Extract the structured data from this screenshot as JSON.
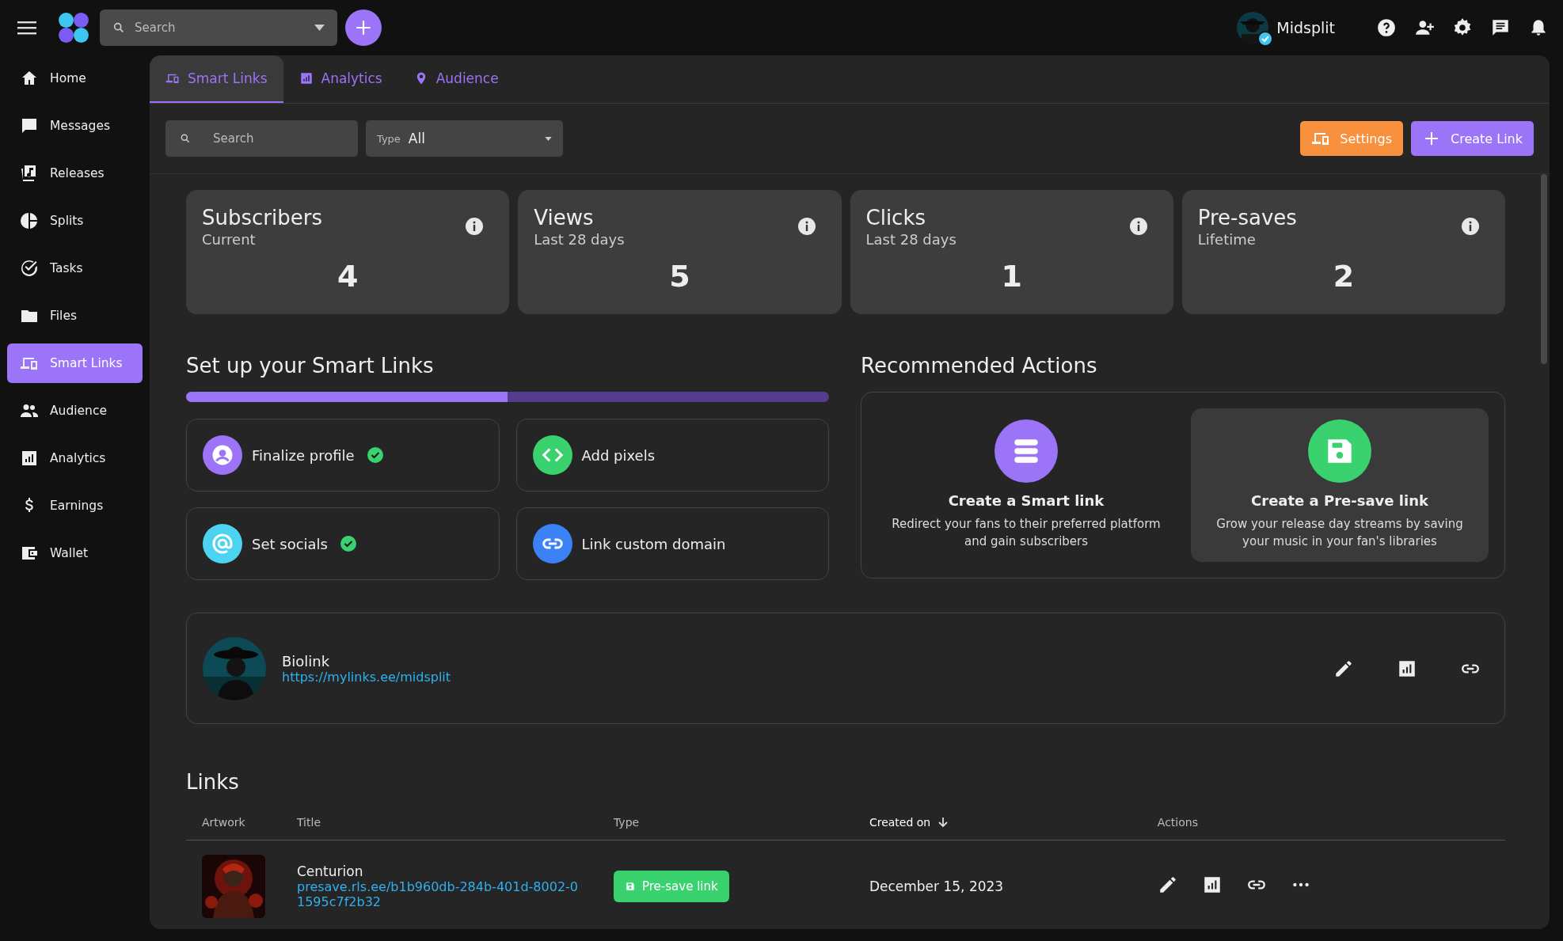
{
  "topbar": {
    "search": {
      "placeholder": "Search"
    },
    "user": {
      "name": "Midsplit",
      "verified": true
    }
  },
  "sidebar": {
    "items": [
      {
        "label": "Home",
        "selected": false
      },
      {
        "label": "Messages",
        "selected": false
      },
      {
        "label": "Releases",
        "selected": false
      },
      {
        "label": "Splits",
        "selected": false
      },
      {
        "label": "Tasks",
        "selected": false
      },
      {
        "label": "Files",
        "selected": false
      },
      {
        "label": "Smart Links",
        "selected": true
      },
      {
        "label": "Audience",
        "selected": false
      },
      {
        "label": "Analytics",
        "selected": false
      },
      {
        "label": "Earnings",
        "selected": false
      },
      {
        "label": "Wallet",
        "selected": false
      }
    ]
  },
  "tabs": [
    {
      "label": "Smart Links",
      "selected": true
    },
    {
      "label": "Analytics",
      "selected": false
    },
    {
      "label": "Audience",
      "selected": false
    }
  ],
  "toolbar": {
    "search": {
      "placeholder": "Search"
    },
    "type_filter": {
      "label": "Type",
      "value": "All"
    },
    "buttons": [
      {
        "label": "Settings",
        "kind": "settings"
      },
      {
        "label": "Create Link",
        "kind": "create"
      }
    ]
  },
  "stats": [
    {
      "title": "Subscribers",
      "subtitle": "Current",
      "value": "4"
    },
    {
      "title": "Views",
      "subtitle": "Last 28 days",
      "value": "5"
    },
    {
      "title": "Clicks",
      "subtitle": "Last 28 days",
      "value": "1"
    },
    {
      "title": "Pre-saves",
      "subtitle": "Lifetime",
      "value": "2"
    }
  ],
  "setup": {
    "title": "Set up your Smart Links",
    "level": 0.5,
    "tasks": [
      {
        "label": "Finalize profile",
        "color": "#9b74f7",
        "done": true
      },
      {
        "label": "Add pixels",
        "color": "#3ad16f",
        "done": false
      },
      {
        "label": "Set socials",
        "color": "#4dd3f2",
        "done": true
      },
      {
        "label": "Link custom domain",
        "color": "#3b82f6",
        "done": false
      }
    ]
  },
  "recommended": {
    "title": "Recommended Actions",
    "actions": [
      {
        "title": "Create a Smart link",
        "description": "Redirect your fans to their preferred platform and gain subscribers",
        "color": "#9b74f7",
        "selected": false
      },
      {
        "title": "Create a Pre-save link",
        "description": "Grow your release day streams by saving your music in your fan's libraries",
        "color": "#3ad16f",
        "selected": true
      }
    ]
  },
  "biolink": {
    "title": "Biolink",
    "url": "https://mylinks.ee/midsplit"
  },
  "links": {
    "title": "Links",
    "columns": [
      {
        "label": "Artwork",
        "sorted": false
      },
      {
        "label": "Title",
        "sorted": false
      },
      {
        "label": "Type",
        "sorted": false
      },
      {
        "label": "Created on",
        "sorted": true
      },
      {
        "label": "Actions",
        "sorted": false
      }
    ],
    "rows": [
      {
        "title": "Centurion",
        "url": "presave.rls.ee/b1b960db-284b-401d-8002-01595c7f2b32",
        "type": "Pre-save link",
        "created": "December 15, 2023"
      }
    ]
  }
}
